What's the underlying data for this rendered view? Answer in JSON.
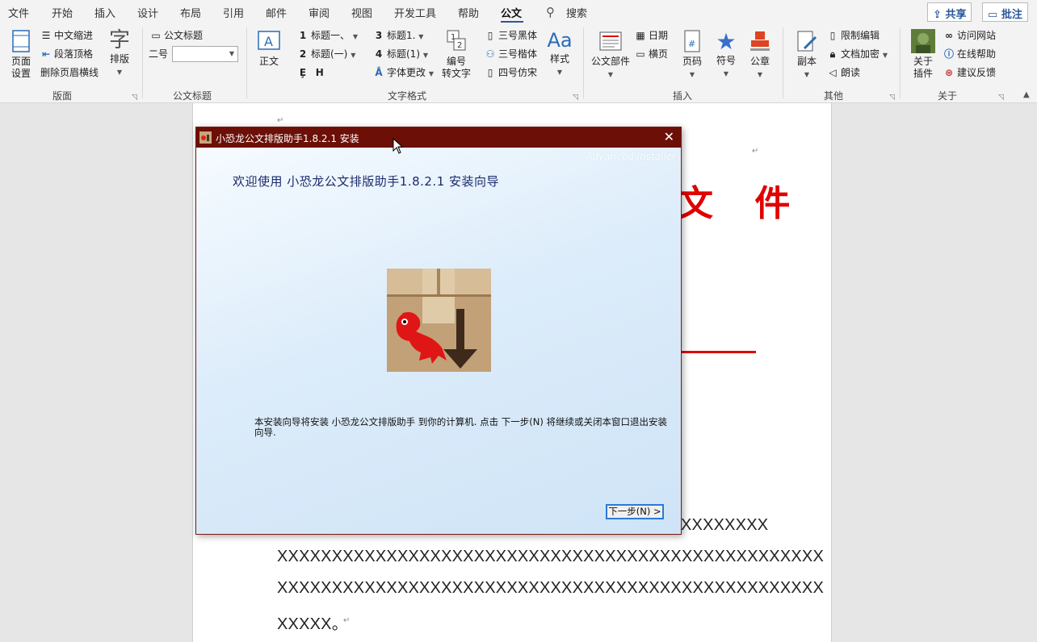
{
  "menubar": {
    "tabs": [
      "文件",
      "开始",
      "插入",
      "设计",
      "布局",
      "引用",
      "邮件",
      "审阅",
      "视图",
      "开发工具",
      "帮助",
      "公文"
    ],
    "active_tab": "公文",
    "search": "搜索",
    "share": "共享",
    "comment": "批注"
  },
  "ribbon": {
    "layout_group": {
      "label": "版面",
      "page_setup": [
        "页面",
        "设置"
      ],
      "chinese_indent": "中文缩进",
      "para_top": "段落顶格",
      "remove_header_line": "删除页眉横线",
      "typeset": "排版"
    },
    "title_group": {
      "label": "公文标题",
      "doc_title": "公文标题",
      "size_label": "二号"
    },
    "text_format_group": {
      "label": "文字格式",
      "body": "正文",
      "h1": "标题一、",
      "h2": "标题(一)",
      "h3": "标题1.",
      "h4": "标题(1)",
      "font_change": "字体更改",
      "num_convert": [
        "编号",
        "转文字"
      ],
      "f1": "三号黑体",
      "f2": "三号楷体",
      "f3": "四号仿宋",
      "style": "样式",
      "n1": "1",
      "n2": "2",
      "n3": "3",
      "n4": "4",
      "e_glyph": "Ȩ",
      "h_glyph": "H"
    },
    "insert_group": {
      "label": "插入",
      "doc_parts": "公文部件",
      "date": "日期",
      "landscape": "横页",
      "page_num": "页码",
      "symbol": "符号",
      "seal": "公章"
    },
    "other_group": {
      "label": "其他",
      "copy": "副本",
      "restrict": "限制编辑",
      "encrypt": "文档加密",
      "read": "朗读"
    },
    "about_group": {
      "label": "关于",
      "about_plugin": [
        "关于",
        "插件"
      ],
      "visit_site": "访问网站",
      "online_help": "在线帮助",
      "feedback": "建议反馈"
    }
  },
  "document": {
    "title_partial": "文 件",
    "x_lines": [
      "XXXXXXXX",
      "XXXXXXXXXXXXXXXXXXXXXXXXXXXXXXXXXXXXXXXXXXXXXXXXXX",
      "XXXXXXXXXXXXXXXXXXXXXXXXXXXXXXXXXXXXXXXXXXXXXXXXXX",
      "XXXXX。"
    ],
    "para_mark": "↵"
  },
  "dialog": {
    "title": "小恐龙公文排版助手1.8.2.1 安装",
    "watermark": "Advanced Installer",
    "welcome": "欢迎使用 小恐龙公文排版助手1.8.2.1 安装向导",
    "description": "本安装向导将安装 小恐龙公文排版助手 到你的计算机. 点击 下一步(N) 将继续或关闭本窗口退出安装向导.",
    "next_button": "下一步(N) >",
    "close": "✕"
  },
  "colors": {
    "accent": "#2b579a",
    "dialog_title_bg": "#6b0f07",
    "doc_red": "#e00000"
  }
}
